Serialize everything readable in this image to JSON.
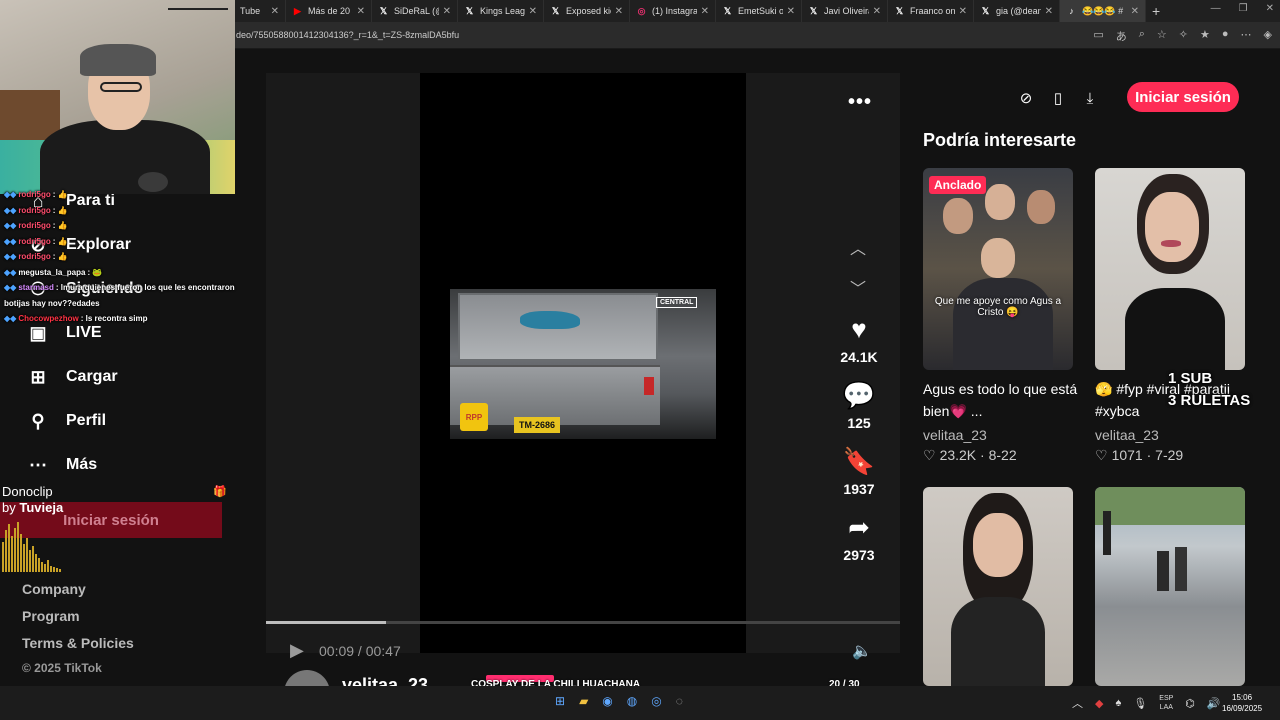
{
  "browser": {
    "tabs": [
      {
        "icon": "",
        "label": "Tube"
      },
      {
        "icon": "youtube-icon",
        "label": "Más de 20 S"
      },
      {
        "icon": "x-icon",
        "label": "SiDeRaL (@"
      },
      {
        "icon": "x-icon",
        "label": "Kings Leagu"
      },
      {
        "icon": "x-icon",
        "label": "Exposed kic"
      },
      {
        "icon": "instagram-icon",
        "label": "(1) Instagra"
      },
      {
        "icon": "x-icon",
        "label": "EmetSuki or"
      },
      {
        "icon": "x-icon",
        "label": "Javi Oliveira"
      },
      {
        "icon": "x-icon",
        "label": "Fraanco on"
      },
      {
        "icon": "x-icon",
        "label": "gia (@deang"
      },
      {
        "icon": "tiktok-icon",
        "label": "😂😂😂 #"
      }
    ],
    "url": "deo/7550588001412304136?_r=1&_t=ZS-8zmalDA5bfu"
  },
  "nav": {
    "items": [
      {
        "label": "Para ti",
        "icon": "home-icon"
      },
      {
        "label": "Explorar",
        "icon": "compass-icon"
      },
      {
        "label": "Siguiendo",
        "icon": "following-icon"
      },
      {
        "label": "LIVE",
        "icon": "live-icon"
      },
      {
        "label": "Cargar",
        "icon": "upload-icon"
      },
      {
        "label": "Perfil",
        "icon": "profile-icon"
      },
      {
        "label": "Más",
        "icon": "more-icon"
      }
    ],
    "footer": [
      "Company",
      "Program",
      "Terms & Policies"
    ],
    "copyright": "© 2025 TikTok"
  },
  "video": {
    "time": "00:09 / 00:47",
    "progress": 0.19,
    "plate_text": "TM-2686",
    "news_logo": "RPP",
    "news_tag": "CENTRAL"
  },
  "actions": {
    "likes": "24.1K",
    "comments": "125",
    "saves": "1937",
    "shares": "2973"
  },
  "header": {
    "login": "Iniciar sesión"
  },
  "recommendations": {
    "title": "Podría interesarte",
    "cards": [
      {
        "badge": "Anclado",
        "caption": "Que me apoye como Agus a Cristo 😝",
        "desc": "Agus es todo lo que está bien💗 ...",
        "author": "velitaa_23",
        "likes": "23.2K",
        "date": "8-22"
      },
      {
        "desc": "🫣 #fyp #viral #paratii #xybca",
        "author": "velitaa_23",
        "likes": "1071",
        "date": "7-29"
      }
    ]
  },
  "chat": [
    {
      "user": "rodri5go",
      "msg": "👍",
      "ucls": "u-rodri"
    },
    {
      "user": "rodri5go",
      "msg": "👍",
      "ucls": "u-rodri"
    },
    {
      "user": "rodri5go",
      "msg": "👍",
      "ucls": "u-rodri"
    },
    {
      "user": "rodri5go",
      "msg": "👍",
      "ucls": "u-rodri"
    },
    {
      "user": "rodri5go",
      "msg": "👍",
      "ucls": "u-rodri"
    },
    {
      "user": "megusta_la_papa",
      "msg": "🐸",
      "ucls": "u-megusta"
    },
    {
      "user": "starmasd",
      "msg": "lmura quienes fueron los que les encontraron",
      "ucls": "u-starm"
    },
    {
      "user": "",
      "msg": "botijas hay nov??edades",
      "ucls": ""
    },
    {
      "user": "Chocowpezhow",
      "msg": "ls recontra simp",
      "ucls": "u-choco"
    }
  ],
  "donation": {
    "title": "Donoclip",
    "by": "by",
    "name": "Tuvieja",
    "login_ghost": "Iniciar sesión"
  },
  "overlay": {
    "sub_line1": "1 SUB",
    "sub_line2": "3 RULETAS"
  },
  "profile": {
    "name": "velitaa_23"
  },
  "goal": {
    "label": "COSPLAY DE LA CHILI HUACHANA",
    "count": "20 / 30",
    "current": 20,
    "total": 30
  },
  "taskbar": {
    "lang_top": "ESP",
    "lang_bottom": "LAA",
    "time": "15:06",
    "date": "16/09/2025"
  },
  "colors": {
    "accent": "#fe2c55",
    "goal_border": "#3ddc3d"
  }
}
